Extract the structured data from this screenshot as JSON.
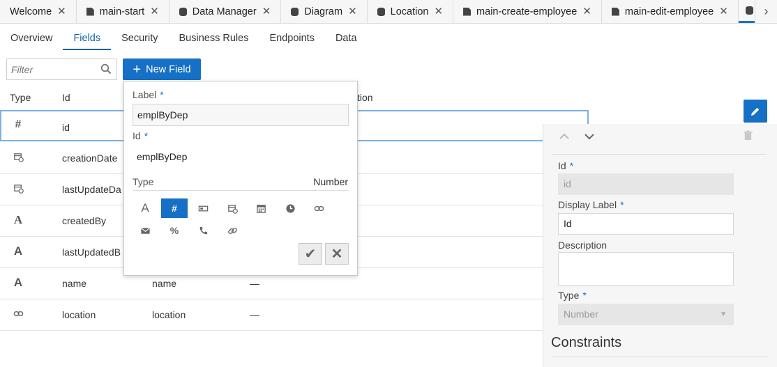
{
  "tabs": [
    {
      "label": "Welcome",
      "icon": "none"
    },
    {
      "label": "main-start",
      "icon": "doc"
    },
    {
      "label": "Data Manager",
      "icon": "db"
    },
    {
      "label": "Diagram",
      "icon": "db"
    },
    {
      "label": "Location",
      "icon": "db"
    },
    {
      "label": "main-create-employee",
      "icon": "doc"
    },
    {
      "label": "main-edit-employee",
      "icon": "doc"
    }
  ],
  "subnav": [
    "Overview",
    "Fields",
    "Security",
    "Business Rules",
    "Endpoints",
    "Data"
  ],
  "subnav_active": "Fields",
  "filter": {
    "placeholder": "Filter"
  },
  "new_field_label": "New Field",
  "table": {
    "headers": {
      "type": "Type",
      "id": "Id",
      "description_partial": "tion"
    },
    "rows": [
      {
        "type_icon": "number-icon",
        "id": "id",
        "label": "",
        "desc": ""
      },
      {
        "type_icon": "datetime-icon",
        "id": "creationDate",
        "label": "",
        "desc": ""
      },
      {
        "type_icon": "datetime-icon",
        "id": "lastUpdateDa",
        "label": "",
        "desc": ""
      },
      {
        "type_icon": "text-icon",
        "id": "createdBy",
        "label": "",
        "desc": ""
      },
      {
        "type_icon": "text-icon",
        "id": "lastUpdatedB",
        "label": "",
        "desc": ""
      },
      {
        "type_icon": "text-icon",
        "id": "name",
        "label": "name",
        "desc": "—"
      },
      {
        "type_icon": "reference-icon",
        "id": "location",
        "label": "location",
        "desc": "—"
      }
    ]
  },
  "popup": {
    "label_title": "Label",
    "label_value": "emplByDep",
    "id_title": "Id",
    "id_value": "emplByDep",
    "type_title": "Type",
    "type_value": "Number",
    "required_mark": "*"
  },
  "panel": {
    "id_title": "Id",
    "id_value": "id",
    "display_label_title": "Display Label",
    "display_label_value": "Id",
    "description_title": "Description",
    "type_title": "Type",
    "type_value": "Number",
    "constraints_title": "Constraints"
  },
  "colors": {
    "accent": "#1570c6",
    "selected_row_border": "#7ab1e6"
  }
}
